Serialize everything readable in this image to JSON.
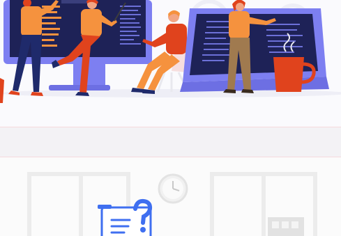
{
  "illustration": {
    "subject": "team-at-work-with-code-screens",
    "icons": [
      "code-monitor-icon",
      "coffee-mug-icon",
      "help-document-icon",
      "clock-icon"
    ],
    "colors": {
      "screen_frame": "#7d7ff1",
      "screen_dark": "#1e2257",
      "accent_orange": "#f5923e",
      "accent_red": "#e0431d",
      "pants_navy": "#1f2a6b",
      "pants_brown": "#a07a4f",
      "band_pink": "#f6d9dd"
    }
  }
}
